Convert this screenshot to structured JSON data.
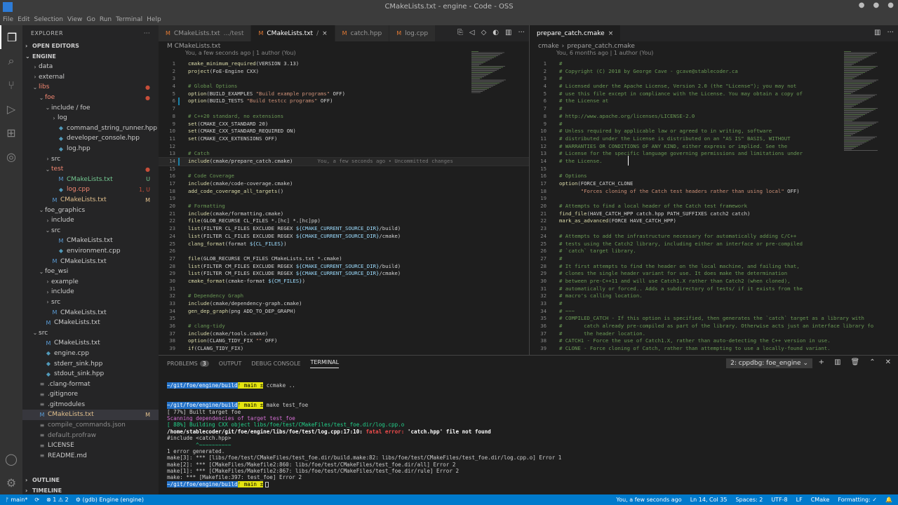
{
  "window": {
    "title": "CMakeLists.txt - engine - Code - OSS"
  },
  "menu": [
    "File",
    "Edit",
    "Selection",
    "View",
    "Go",
    "Run",
    "Terminal",
    "Help"
  ],
  "explorer": {
    "header": "EXPLORER",
    "open_editors": "OPEN EDITORS",
    "root": "ENGINE",
    "outline": "OUTLINE",
    "timeline": "TIMELINE",
    "items": [
      {
        "label": "data",
        "depth": 1,
        "type": "folder",
        "open": false,
        "status": ""
      },
      {
        "label": "external",
        "depth": 1,
        "type": "folder",
        "open": false,
        "status": ""
      },
      {
        "label": "libs",
        "depth": 1,
        "type": "folder",
        "open": true,
        "status": "err",
        "badge": "●"
      },
      {
        "label": "foe",
        "depth": 2,
        "type": "folder",
        "open": true,
        "status": "err",
        "badge": "●"
      },
      {
        "label": "include / foe",
        "depth": 3,
        "type": "folder",
        "open": true,
        "status": ""
      },
      {
        "label": "log",
        "depth": 4,
        "type": "folder",
        "open": false,
        "status": ""
      },
      {
        "label": "command_string_runner.hpp",
        "depth": 4,
        "type": "file",
        "status": ""
      },
      {
        "label": "developer_console.hpp",
        "depth": 4,
        "type": "file",
        "status": ""
      },
      {
        "label": "log.hpp",
        "depth": 4,
        "type": "file",
        "status": ""
      },
      {
        "label": "src",
        "depth": 3,
        "type": "folder",
        "open": false,
        "status": ""
      },
      {
        "label": "test",
        "depth": 3,
        "type": "folder",
        "open": true,
        "status": "err",
        "badge": "●"
      },
      {
        "label": "CMakeLists.txt",
        "depth": 4,
        "type": "cmake",
        "status": "unt",
        "badge": "U"
      },
      {
        "label": "log.cpp",
        "depth": 4,
        "type": "file",
        "status": "err",
        "badge": "1, U"
      },
      {
        "label": "CMakeLists.txt",
        "depth": 3,
        "type": "cmake",
        "status": "mod",
        "badge": "M"
      },
      {
        "label": "foe_graphics",
        "depth": 2,
        "type": "folder",
        "open": true,
        "status": ""
      },
      {
        "label": "include",
        "depth": 3,
        "type": "folder",
        "open": false,
        "status": ""
      },
      {
        "label": "src",
        "depth": 3,
        "type": "folder",
        "open": true,
        "status": ""
      },
      {
        "label": "CMakeLists.txt",
        "depth": 4,
        "type": "cmake",
        "status": ""
      },
      {
        "label": "environment.cpp",
        "depth": 4,
        "type": "file",
        "status": ""
      },
      {
        "label": "CMakeLists.txt",
        "depth": 3,
        "type": "cmake",
        "status": ""
      },
      {
        "label": "foe_wsi",
        "depth": 2,
        "type": "folder",
        "open": true,
        "status": ""
      },
      {
        "label": "example",
        "depth": 3,
        "type": "folder",
        "open": false,
        "status": ""
      },
      {
        "label": "include",
        "depth": 3,
        "type": "folder",
        "open": false,
        "status": ""
      },
      {
        "label": "src",
        "depth": 3,
        "type": "folder",
        "open": false,
        "status": ""
      },
      {
        "label": "CMakeLists.txt",
        "depth": 3,
        "type": "cmake",
        "status": ""
      },
      {
        "label": "CMakeLists.txt",
        "depth": 2,
        "type": "cmake",
        "status": ""
      },
      {
        "label": "src",
        "depth": 1,
        "type": "folder",
        "open": true,
        "status": ""
      },
      {
        "label": "CMakeLists.txt",
        "depth": 2,
        "type": "cmake",
        "status": ""
      },
      {
        "label": "engine.cpp",
        "depth": 2,
        "type": "file",
        "status": ""
      },
      {
        "label": "stderr_sink.hpp",
        "depth": 2,
        "type": "file",
        "status": ""
      },
      {
        "label": "stdout_sink.hpp",
        "depth": 2,
        "type": "file",
        "status": ""
      },
      {
        "label": ".clang-format",
        "depth": 1,
        "type": "plain",
        "status": ""
      },
      {
        "label": ".gitignore",
        "depth": 1,
        "type": "plain",
        "status": ""
      },
      {
        "label": ".gitmodules",
        "depth": 1,
        "type": "plain",
        "status": ""
      },
      {
        "label": "CMakeLists.txt",
        "depth": 1,
        "type": "cmake",
        "status": "mod",
        "badge": "M",
        "selected": true
      },
      {
        "label": "compile_commands.json",
        "depth": 1,
        "type": "plain",
        "status": "ign"
      },
      {
        "label": "default.profraw",
        "depth": 1,
        "type": "plain",
        "status": "ign"
      },
      {
        "label": "LICENSE",
        "depth": 1,
        "type": "plain",
        "status": ""
      },
      {
        "label": "README.md",
        "depth": 1,
        "type": "plain",
        "status": ""
      }
    ]
  },
  "editor1": {
    "tabs": [
      {
        "label": "CMakeLists.txt",
        "hint": ".../test",
        "active": false
      },
      {
        "label": "CMakeLists.txt",
        "hint": "/",
        "active": true,
        "close": "×"
      },
      {
        "label": "catch.hpp",
        "hint": "",
        "active": false
      },
      {
        "label": "log.cpp",
        "hint": "",
        "active": false
      }
    ],
    "breadcrumb": "M CMakeLists.txt",
    "blame": "You, a few seconds ago | 1 author (You)",
    "lines": [
      "cmake_minimum_required(VERSION 3.13)",
      "project(FoE-Engine CXX)",
      "",
      "# Global Options",
      "option(BUILD_EXAMPLES \"Build example programs\" OFF)",
      "option(BUILD_TESTS \"Build testcc programs\" OFF)",
      "",
      "# C++20 standard, no extensions",
      "set(CMAKE_CXX_STANDARD 20)",
      "set(CMAKE_CXX_STANDARD_REQUIRED ON)",
      "set(CMAKE_CXX_EXTENSIONS OFF)",
      "",
      "# Catch",
      "include(cmake/prepare_catch.cmake)",
      "",
      "# Code Coverage",
      "include(cmake/code-coverage.cmake)",
      "add_code_coverage_all_targets()",
      "",
      "# Formatting",
      "include(cmake/formatting.cmake)",
      "file(GLOB_RECURSE CL_FILES *.[hc] *.[hc]pp)",
      "list(FILTER CL_FILES EXCLUDE REGEX ${CMAKE_CURRENT_SOURCE_DIR}/build)",
      "list(FILTER CL_FILES EXCLUDE REGEX ${CMAKE_CURRENT_SOURCE_DIR}/cmake)",
      "clang_format(format ${CL_FILES})",
      "",
      "file(GLOB_RECURSE CM_FILES CMakeLists.txt *.cmake)",
      "list(FILTER CM_FILES EXCLUDE REGEX ${CMAKE_CURRENT_SOURCE_DIR}/build)",
      "list(FILTER CM_FILES EXCLUDE REGEX ${CMAKE_CURRENT_SOURCE_DIR}/cmake)",
      "cmake_format(cmake-format ${CM_FILES})",
      "",
      "# Dependency Graph",
      "include(cmake/dependency-graph.cmake)",
      "gen_dep_graph(png ADD_TO_DEP_GRAPH)",
      "",
      "# clang-tidy",
      "include(cmake/tools.cmake)",
      "option(CLANG_TIDY_FIX \"\" OFF)",
      "if(CLANG_TIDY_FIX)"
    ],
    "inline_blame": "You, a few seconds ago • Uncommitted changes"
  },
  "editor2": {
    "tab": "prepare_catch.cmake",
    "close": "×",
    "breadcrumb_folder": "cmake",
    "breadcrumb_file": "prepare_catch.cmake",
    "blame": "You, 6 months ago | 1 author (You)",
    "lines": [
      "#",
      "# Copyright (C) 2018 by George Cave - gcave@stablecoder.ca",
      "#",
      "# Licensed under the Apache License, Version 2.0 (the \"License\"); you may not",
      "# use this file except in compliance with the License. You may obtain a copy of",
      "# the License at",
      "#",
      "# http://www.apache.org/licenses/LICENSE-2.0",
      "#",
      "# Unless required by applicable law or agreed to in writing, software",
      "# distributed under the License is distributed on an \"AS IS\" BASIS, WITHOUT",
      "# WARRANTIES OR CONDITIONS OF ANY KIND, either express or implied. See the",
      "# License for the specific language governing permissions and limitations under",
      "# the License.",
      "",
      "# Options",
      "option(FORCE_CATCH_CLONE",
      "       \"Forces cloning of the Catch test headers rather than using local\" OFF)",
      "",
      "# Attempts to find a local header of the Catch test framework",
      "find_file(HAVE_CATCH_HPP catch.hpp PATH_SUFFIXES catch2 catch)",
      "mark_as_advanced(FORCE HAVE_CATCH_HPP)",
      "",
      "# Attempts to add the infrastructure necessary for automatically adding C/C++",
      "# tests using the Catch2 library, including either an interface or pre-compiled",
      "# `catch` target library.",
      "#",
      "# It first attempts to find the header on the local machine, and failing that,",
      "# clones the single header variant for use. It does make the determination",
      "# between pre-C++11 and will use Catch1.X rather than Catch2 (when cloned),",
      "# automatically or forced.. Adds a subdirectory of tests/ if it exists from the",
      "# macro's calling location.",
      "#",
      "# ~~~",
      "# COMPILED_CATCH - If this option is specified, then generates the `catch` target as a library with",
      "#       catch already pre-compiled as part of the library. Otherwise acts just an interface library fo",
      "#       the header location.",
      "# CATCH1 - Force the use of Catch1.X, rather than auto-detecting the C++ version in use.",
      "# CLONE - Force cloning of Catch, rather than attempting to use a locally-found variant."
    ]
  },
  "panel": {
    "tabs": [
      "PROBLEMS",
      "OUTPUT",
      "DEBUG CONSOLE",
      "TERMINAL"
    ],
    "problems_count": "3",
    "active": "TERMINAL",
    "terminal_select": "2: cppdbg: foe_engine",
    "terminal": {
      "prompt_path": "~/git/foe/engine/build",
      "prompt_branch": "ᚠ main ±",
      "cmd1": " ccmake ..",
      "cmd2": " make test_foe",
      "out": [
        {
          "t": "[ 77%] Built target foe",
          "c": ""
        },
        {
          "t": "Scanning dependencies of target test_foe",
          "c": "tmag"
        },
        {
          "t": "[ 88%] Building CXX object libs/foe/test/CMakeFiles/test_foe.dir/log.cpp.o",
          "c": "tgreen"
        }
      ],
      "err_path": "/home/stablecoder/git/foe/engine/libs/foe/test/log.cpp:17:10: ",
      "err_word": "fatal error: ",
      "err_msg": "'catch.hpp' file not found",
      "include_line": "#include <catch.hpp>",
      "caret": "         ^~~~~~~~~~~",
      "tail": [
        "1 error generated.",
        "make[3]: *** [libs/foe/test/CMakeFiles/test_foe.dir/build.make:82: libs/foe/test/CMakeFiles/test_foe.dir/log.cpp.o] Error 1",
        "make[2]: *** [CMakeFiles/Makefile2:860: libs/foe/test/CMakeFiles/test_foe.dir/all] Error 2",
        "make[1]: *** [CMakeFiles/Makefile2:867: libs/foe/test/CMakeFiles/test_foe.dir/rule] Error 2",
        "make: *** [Makefile:397: test_foe] Error 2"
      ]
    }
  },
  "status": {
    "branch": "ᚠ main*",
    "sync": "⟳",
    "problems": "⊗ 1 ⚠ 2",
    "debug": "⚙ (gdb) Engine (engine)",
    "blame": "You, a few seconds ago",
    "position": "Ln 14, Col 35",
    "spaces": "Spaces: 2",
    "encoding": "UTF-8",
    "eol": "LF",
    "lang": "CMake",
    "formatting": "Formatting: ✓",
    "bell": "🔔"
  }
}
